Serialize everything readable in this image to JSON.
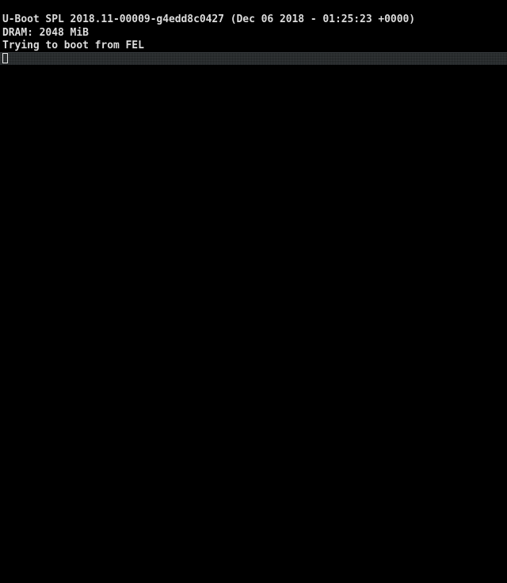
{
  "terminal": {
    "lines": [
      "U-Boot SPL 2018.11-00009-g4edd8c0427 (Dec 06 2018 - 01:25:23 +0000)",
      "DRAM: 2048 MiB",
      "Trying to boot from FEL"
    ],
    "colors": {
      "background": "#000000",
      "text": "#dcdcdc",
      "status_bar": "#2a2e30",
      "cursor": "#e0e0e0"
    }
  }
}
